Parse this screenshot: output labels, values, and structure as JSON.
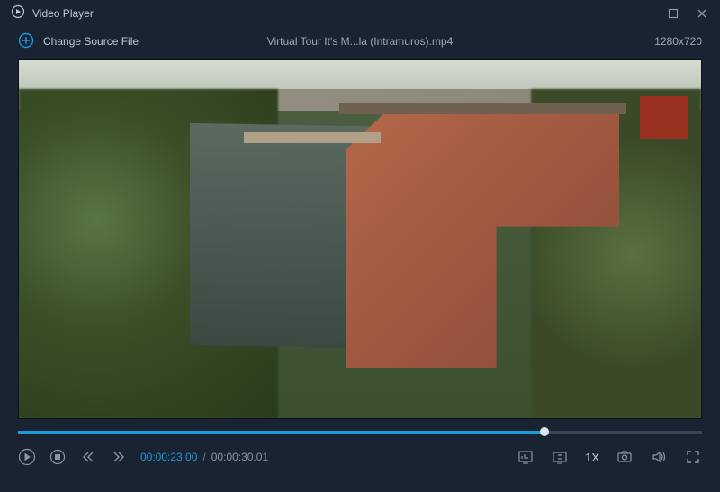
{
  "titlebar": {
    "title": "Video Player"
  },
  "subheader": {
    "change_source_label": "Change Source File",
    "filename": "Virtual Tour It's M...la (Intramuros).mp4",
    "resolution": "1280x720"
  },
  "playback": {
    "current_time": "00:00:23.00",
    "separator": "/",
    "total_time": "00:00:30.01",
    "speed": "1X"
  }
}
